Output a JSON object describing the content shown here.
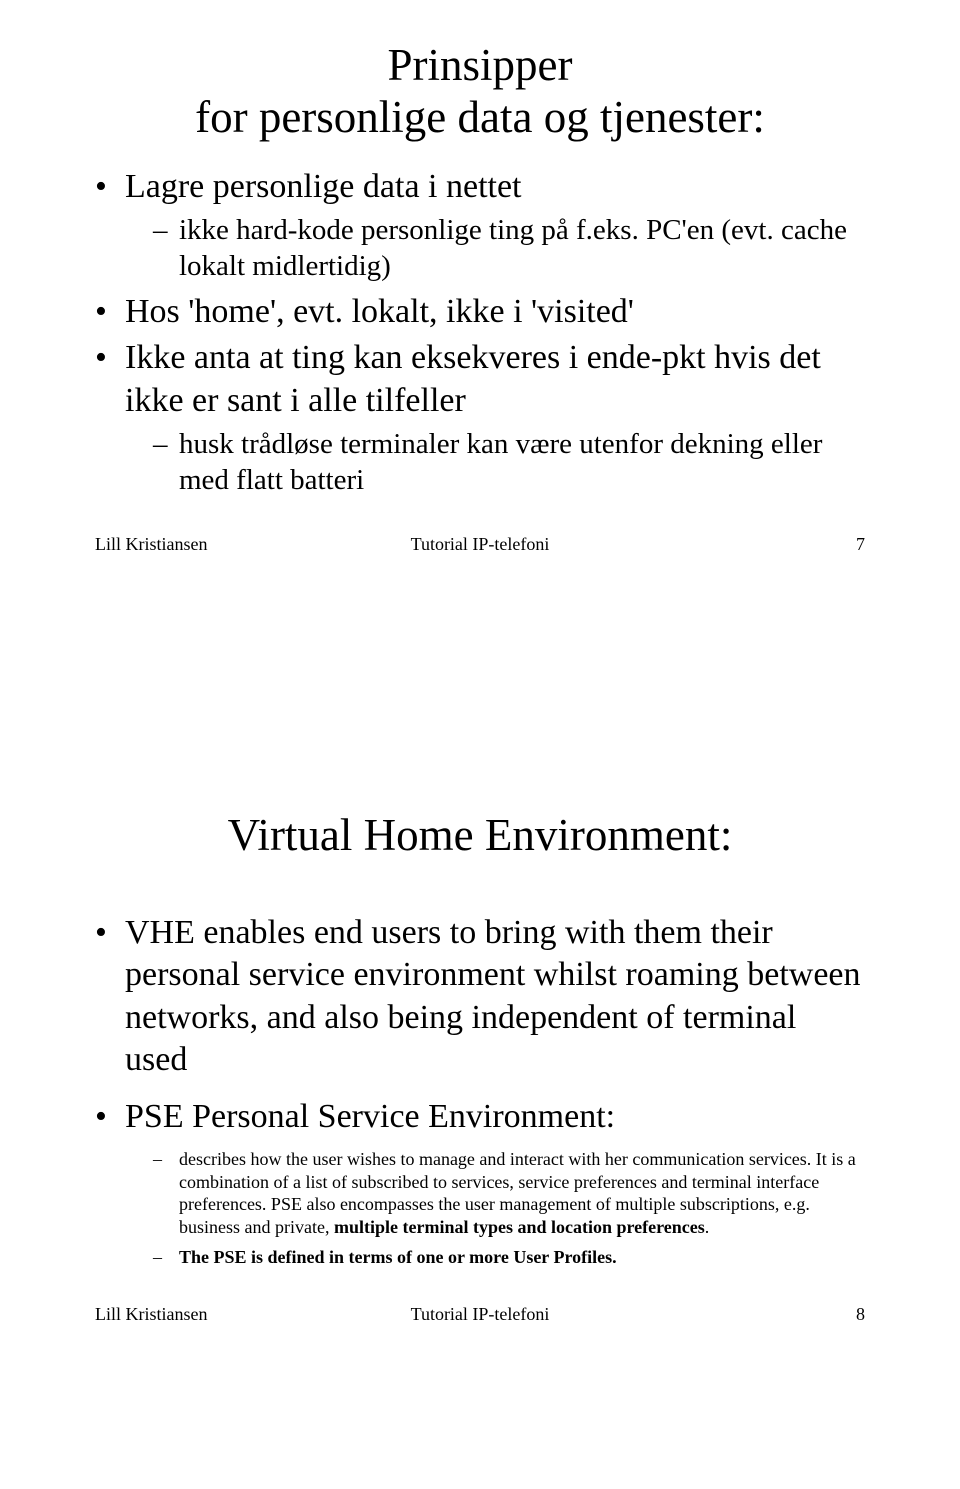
{
  "slide1": {
    "title_line1": "Prinsipper",
    "title_line2": "for personlige data og tjenester:",
    "b1": "Lagre personlige  data i nettet",
    "b1_1": "ikke hard-kode personlige ting på f.eks. PC'en (evt. cache lokalt midlertidig)",
    "b2": "Hos 'home', evt. lokalt,  ikke i 'visited'",
    "b3": "Ikke anta at ting kan eksekveres i ende-pkt hvis det ikke er sant i alle tilfeller",
    "b3_1": "husk trådløse terminaler kan være utenfor dekning eller med flatt batteri",
    "footer_left": "Lill Kristiansen",
    "footer_center": "Tutorial IP-telefoni",
    "footer_right": "7"
  },
  "slide2": {
    "title": "Virtual Home Environment:",
    "b1": "VHE enables end users to bring with them their personal service environment whilst roaming between networks, and also being independent of terminal used",
    "b2": "PSE Personal Service Environment:",
    "b2_1_pre": "describes how the user wishes to manage and interact with her communication services. It is a combination of a list of subscribed to services, service preferences and terminal interface preferences. PSE also encompasses the user management of multiple subscriptions, e.g. business and private, ",
    "b2_1_bold": "multiple terminal types and location preferences",
    "b2_1_post": ".",
    "b2_2": "The PSE is defined in terms of one or more User Profiles.",
    "footer_left": "Lill Kristiansen",
    "footer_center": "Tutorial IP-telefoni",
    "footer_right": "8"
  }
}
